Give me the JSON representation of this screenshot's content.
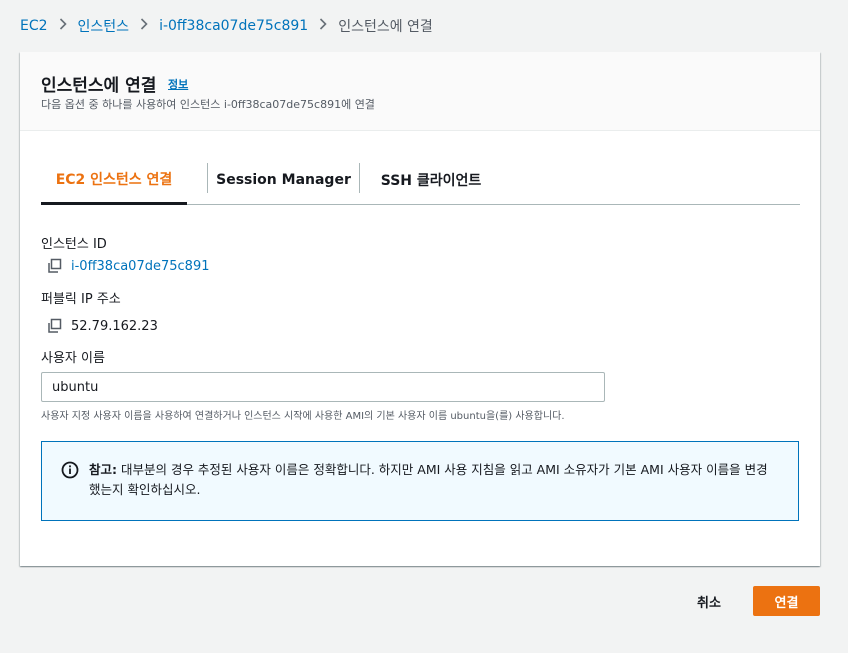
{
  "breadcrumb": {
    "items": [
      "EC2",
      "인스턴스",
      "i-0ff38ca07de75c891"
    ],
    "current": "인스턴스에 연결"
  },
  "panel": {
    "title": "인스턴스에 연결",
    "info_link": "정보",
    "description": "다음 옵션 중 하나를 사용하여 인스턴스 i-0ff38ca07de75c891에 연결"
  },
  "tabs": [
    {
      "label": "EC2 인스턴스 연결",
      "active": true
    },
    {
      "label": "Session Manager",
      "active": false
    },
    {
      "label": "SSH 클라이언트",
      "active": false
    }
  ],
  "fields": {
    "instance_id_label": "인스턴스 ID",
    "instance_id_value": "i-0ff38ca07de75c891",
    "public_ip_label": "퍼블릭 IP 주소",
    "public_ip_value": "52.79.162.23",
    "username_label": "사용자 이름",
    "username_value": "ubuntu",
    "username_hint": "사용자 지정 사용자 이름을 사용하여 연결하거나 인스턴스 시작에 사용한 AMI의 기본 사용자 이름 ubuntu을(를) 사용합니다."
  },
  "alert": {
    "title": "참고:",
    "text": " 대부분의 경우 추정된 사용자 이름은 정확합니다. 하지만 AMI 사용 지침을 읽고 AMI 소유자가 기본 AMI 사용자 이름을 변경했는지 확인하십시오."
  },
  "footer": {
    "cancel_label": "취소",
    "connect_label": "연결"
  },
  "colors": {
    "link": "#0073bb",
    "accent": "#ec7211",
    "text": "#16191f",
    "background": "#f2f3f3"
  },
  "icons": {
    "copy": "copy-icon",
    "info": "info-circle-icon",
    "chevron": "chevron-right-icon"
  }
}
